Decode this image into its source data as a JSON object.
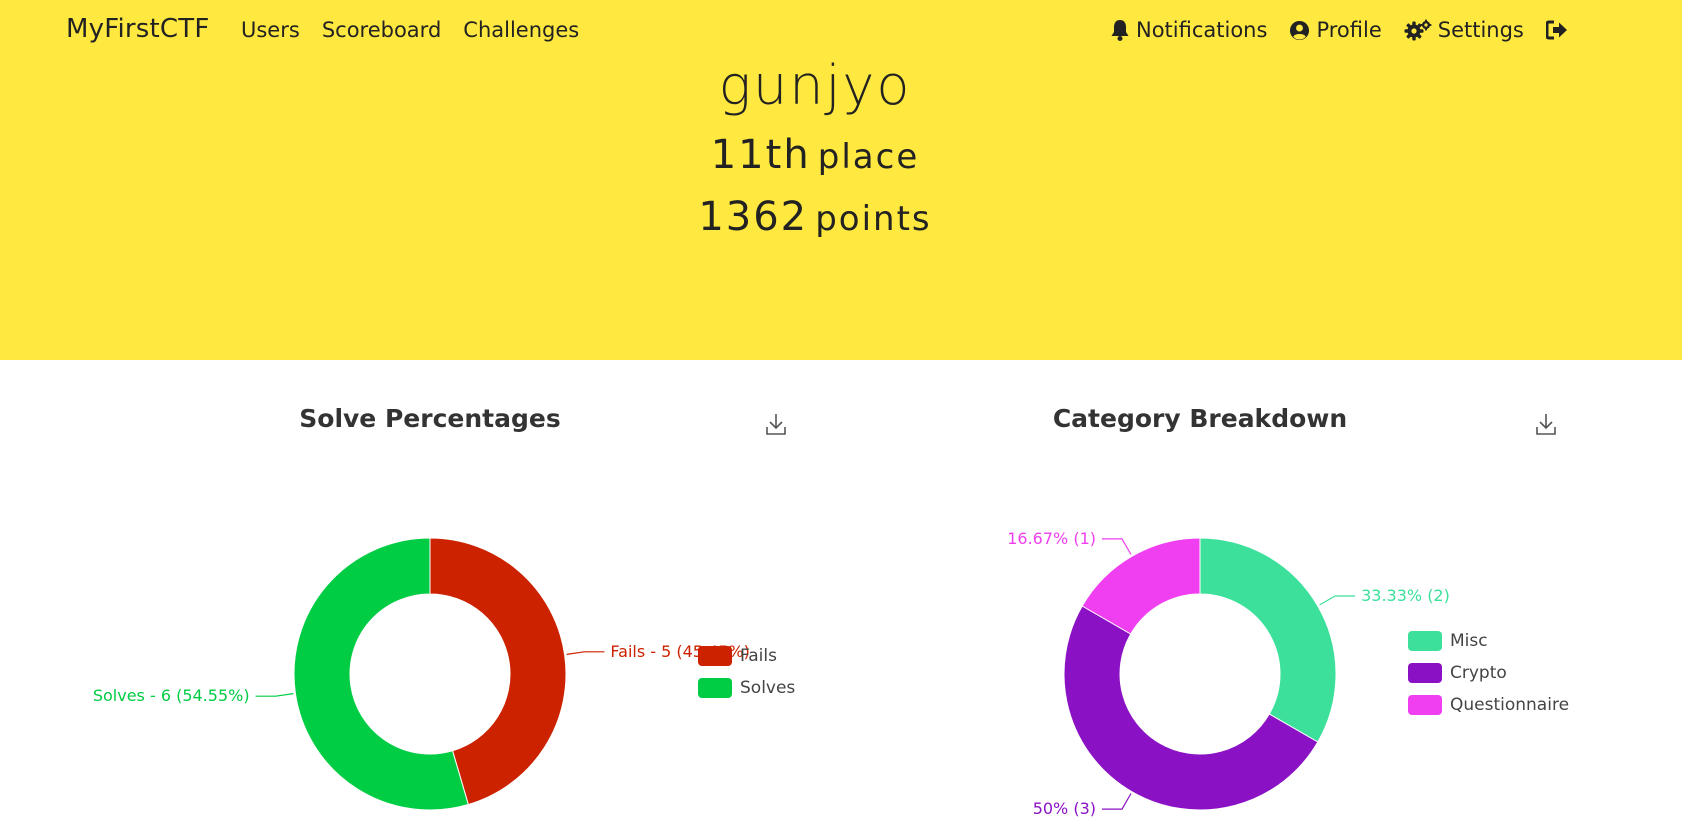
{
  "nav": {
    "brand": "MyFirstCTF",
    "left": [
      "Users",
      "Scoreboard",
      "Challenges"
    ],
    "notifications": "Notifications",
    "profile": "Profile",
    "settings": "Settings",
    "logout_icon": "sign-out-icon"
  },
  "user": {
    "name": "gunjyo",
    "place_num": "11th",
    "place_word": "place",
    "points_num": "1362",
    "points_word": "points"
  },
  "colors": {
    "hero_bg": "#ffe83f",
    "fails": "#cc2200",
    "solves": "#00cc44",
    "misc": "#3ce09b",
    "crypto": "#8a12c4",
    "questionnaire": "#ef3ff0"
  },
  "chart_data": [
    {
      "type": "pie",
      "title": "Solve Percentages",
      "categories": [
        "Fails",
        "Solves"
      ],
      "values": [
        5,
        6
      ],
      "labels": [
        "Fails - 5 (45.45%)",
        "Solves - 6 (54.55%)"
      ],
      "legend": "right"
    },
    {
      "type": "pie",
      "title": "Category Breakdown",
      "categories": [
        "Misc",
        "Crypto",
        "Questionnaire"
      ],
      "values": [
        2,
        3,
        1
      ],
      "labels": [
        "33.33% (2)",
        "50% (3)",
        "16.67% (1)"
      ],
      "legend": "right"
    }
  ]
}
